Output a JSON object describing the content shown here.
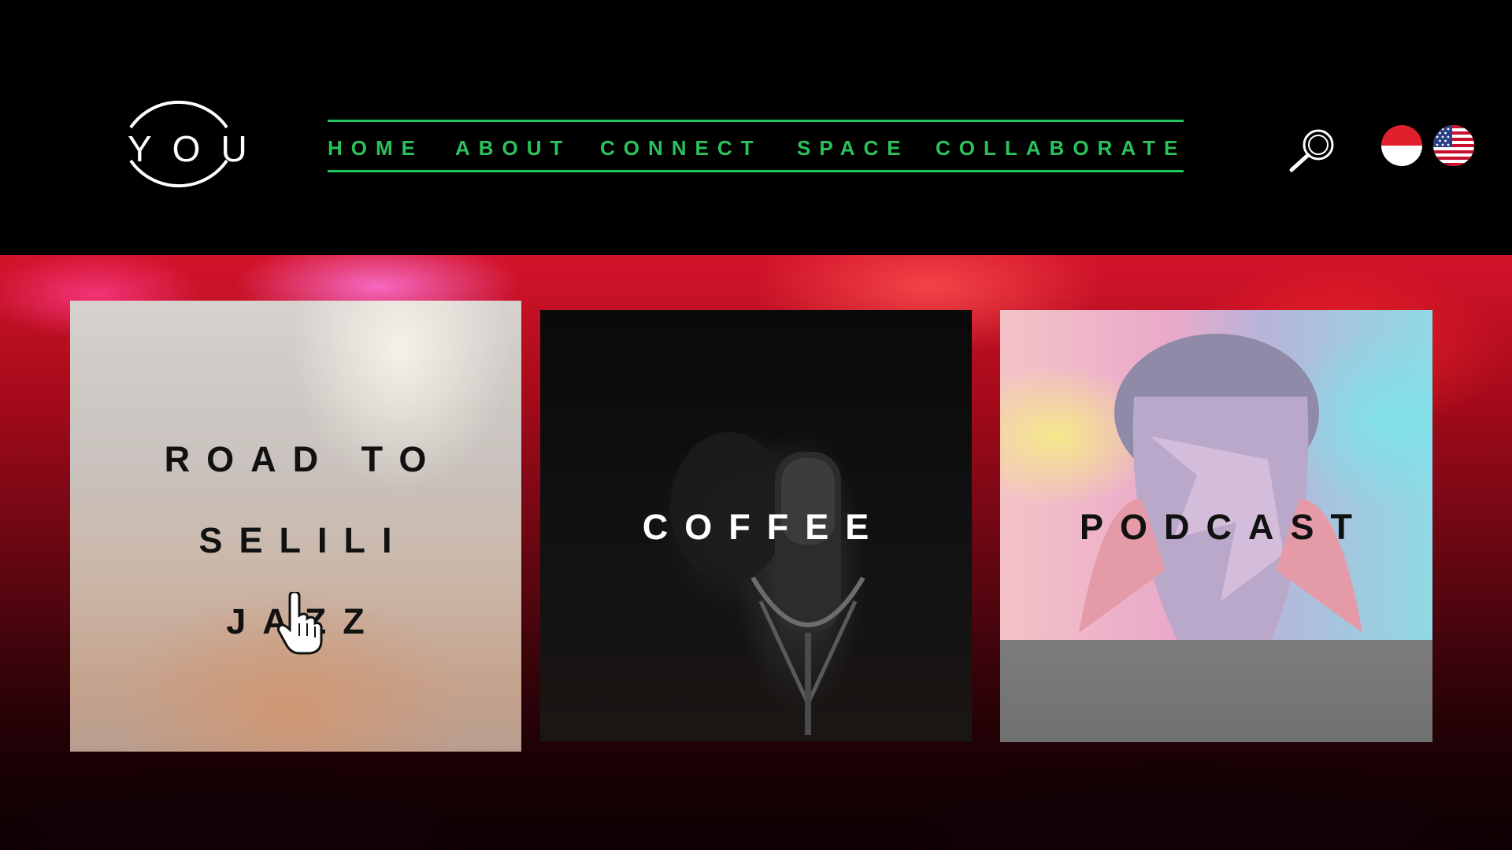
{
  "logo": {
    "text": "YOU"
  },
  "nav": {
    "items": [
      {
        "label": "HOME"
      },
      {
        "label": "ABOUT"
      },
      {
        "label": "CONNECT"
      },
      {
        "label": "SPACE"
      },
      {
        "label": "COLLABORATE"
      }
    ]
  },
  "icons": {
    "search": "search-icon",
    "flag_1": "indonesia-flag-icon",
    "flag_2": "us-flag-icon",
    "cursor": "hand-pointer-icon"
  },
  "cards": [
    {
      "lines": [
        "ROAD TO",
        "SELILI",
        "JAZZ"
      ]
    },
    {
      "label": "COFFEE"
    },
    {
      "label": "PODCAST"
    }
  ],
  "colors": {
    "accent": "#2bc25c",
    "background": "#000000",
    "hero": "#b3101f"
  }
}
